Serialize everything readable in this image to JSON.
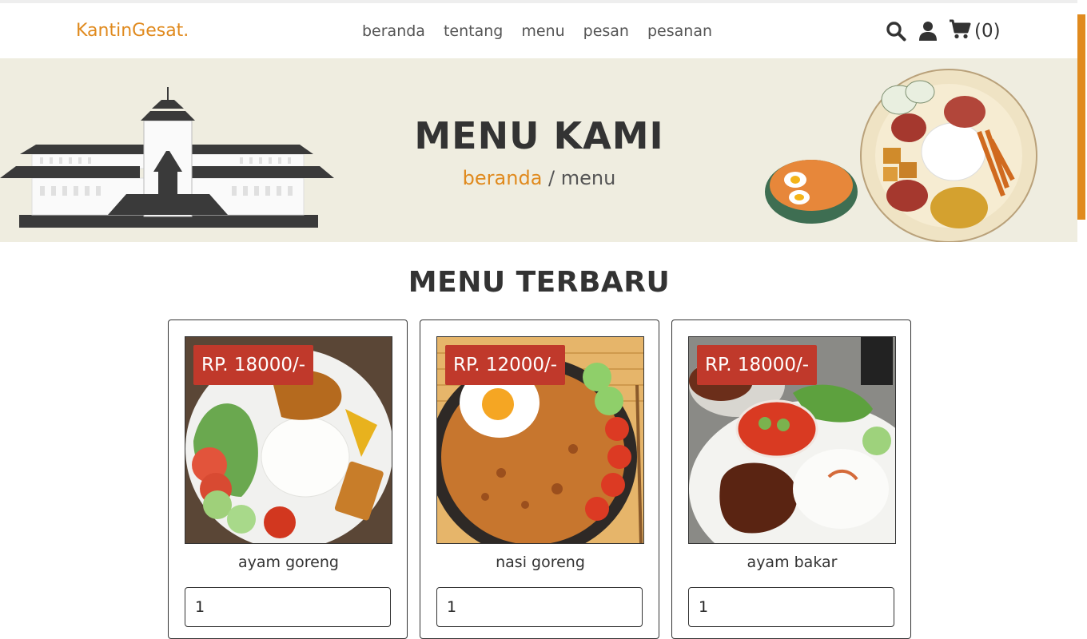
{
  "header": {
    "logo": "KantinGesat.",
    "nav": [
      "beranda",
      "tentang",
      "menu",
      "pesan",
      "pesanan"
    ],
    "cart_count": "(0)"
  },
  "banner": {
    "title": "MENU KAMI",
    "breadcrumb_link": "beranda",
    "breadcrumb_sep": " / ",
    "breadcrumb_current": "menu"
  },
  "section": {
    "title": "MENU TERBARU"
  },
  "menu_items": [
    {
      "price": "RP. 18000/-",
      "name": "ayam goreng",
      "qty": "1"
    },
    {
      "price": "RP. 12000/-",
      "name": "nasi goreng",
      "qty": "1"
    },
    {
      "price": "RP. 18000/-",
      "name": "ayam bakar",
      "qty": "1"
    }
  ],
  "colors": {
    "accent": "#e08a1e",
    "price_badge": "#c0392b",
    "banner_bg": "#efede0"
  },
  "icons": [
    "search-icon",
    "user-icon",
    "cart-icon"
  ]
}
